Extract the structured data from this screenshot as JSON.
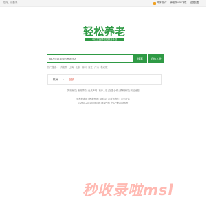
{
  "topbar": {
    "left_text": "您好，请登录",
    "items": [
      "简体/繁体",
      "养老院APP下载",
      "全国加盟"
    ]
  },
  "logo": {
    "text": "轻松养老",
    "subtitle": "寻找全国养老院服务平台"
  },
  "search": {
    "placeholder": "输入您要搜索的养老院名",
    "button": "搜索",
    "join_button": "机构入驻"
  },
  "hot": {
    "items": [
      "热门搜索：",
      "养老院",
      "上海",
      "北京",
      "深圳",
      "浙江",
      "广州",
      "敬老院"
    ]
  },
  "city": {
    "label": "杭州",
    "sep": "›",
    "value": "全部"
  },
  "links": "关于我们 | 使用帮助 | 免责声明 | 商户入驻 | 加盟合作 | 联系我们 | 网站地图",
  "footer": {
    "line1": "轻松养老网 | 养老资讯 | 帮助中心 | 联系我们 | 意见反馈",
    "copy": "© 2008-2021 xxxx.com 版权所有 沪ICP备000000号"
  },
  "watermark": "秒收录啦msl"
}
